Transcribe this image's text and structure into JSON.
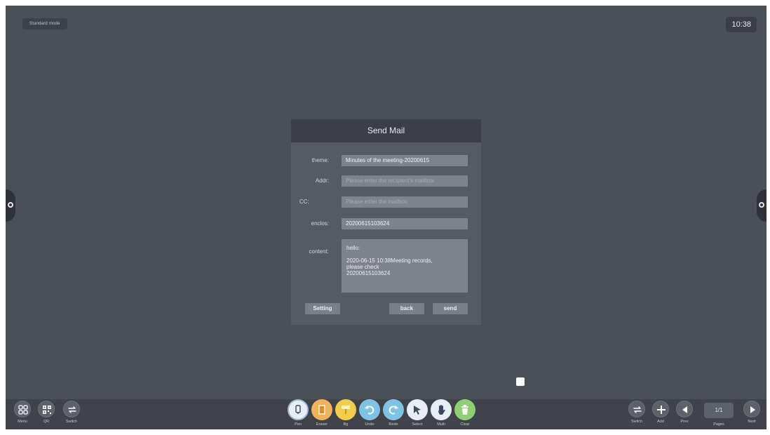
{
  "status": {
    "mode": "Standard mode",
    "time": "10:38"
  },
  "dialog": {
    "title": "Send Mail",
    "theme": {
      "label": "theme:",
      "value": "Minutes of the meeting-20200615"
    },
    "addr": {
      "label": "Addr:",
      "placeholder": "Please enter the recipient's mailbox"
    },
    "cc": {
      "label": "CC:",
      "placeholder": "Please enter the mailbox"
    },
    "enclos": {
      "label": "enclos:",
      "value": "20200615103624"
    },
    "content": {
      "label": "content:",
      "lines": [
        "hello:",
        "",
        "2020-06-15 10:38Meeting records,",
        "please check",
        "20200615103624"
      ]
    },
    "buttons": {
      "setting": "Setting",
      "back": "back",
      "send": "send"
    }
  },
  "toolbar": {
    "left": [
      {
        "label": "Menu",
        "icon": "menu-grid-icon"
      },
      {
        "label": "QR",
        "icon": "qr-code-icon"
      },
      {
        "label": "Switch",
        "icon": "switch-arrows-icon"
      }
    ],
    "tools": [
      {
        "label": "Pen",
        "icon": "pen-icon",
        "color": "#e9eef5"
      },
      {
        "label": "Eraser",
        "icon": "eraser-icon",
        "color": "#f0b25a"
      },
      {
        "label": "Bg",
        "icon": "background-brush-icon",
        "color": "#f2cc4d"
      },
      {
        "label": "Undo",
        "icon": "undo-icon",
        "color": "#7fc2e6"
      },
      {
        "label": "Redo",
        "icon": "redo-icon",
        "color": "#7fc2e6"
      },
      {
        "label": "Select",
        "icon": "select-cursor-icon",
        "color": "#e9eef5"
      },
      {
        "label": "Multi",
        "icon": "multi-touch-hand-icon",
        "color": "#e9eef5"
      },
      {
        "label": "Clear",
        "icon": "trash-icon",
        "color": "#8fd077"
      }
    ],
    "right": [
      {
        "label": "Switch",
        "icon": "switch-arrows-icon"
      },
      {
        "label": "Add",
        "icon": "add-plus-icon"
      },
      {
        "label": "Prev",
        "icon": "prev-triangle-icon"
      },
      {
        "label": "Pages",
        "value": "1/1"
      },
      {
        "label": "Next",
        "icon": "next-triangle-icon"
      }
    ]
  }
}
